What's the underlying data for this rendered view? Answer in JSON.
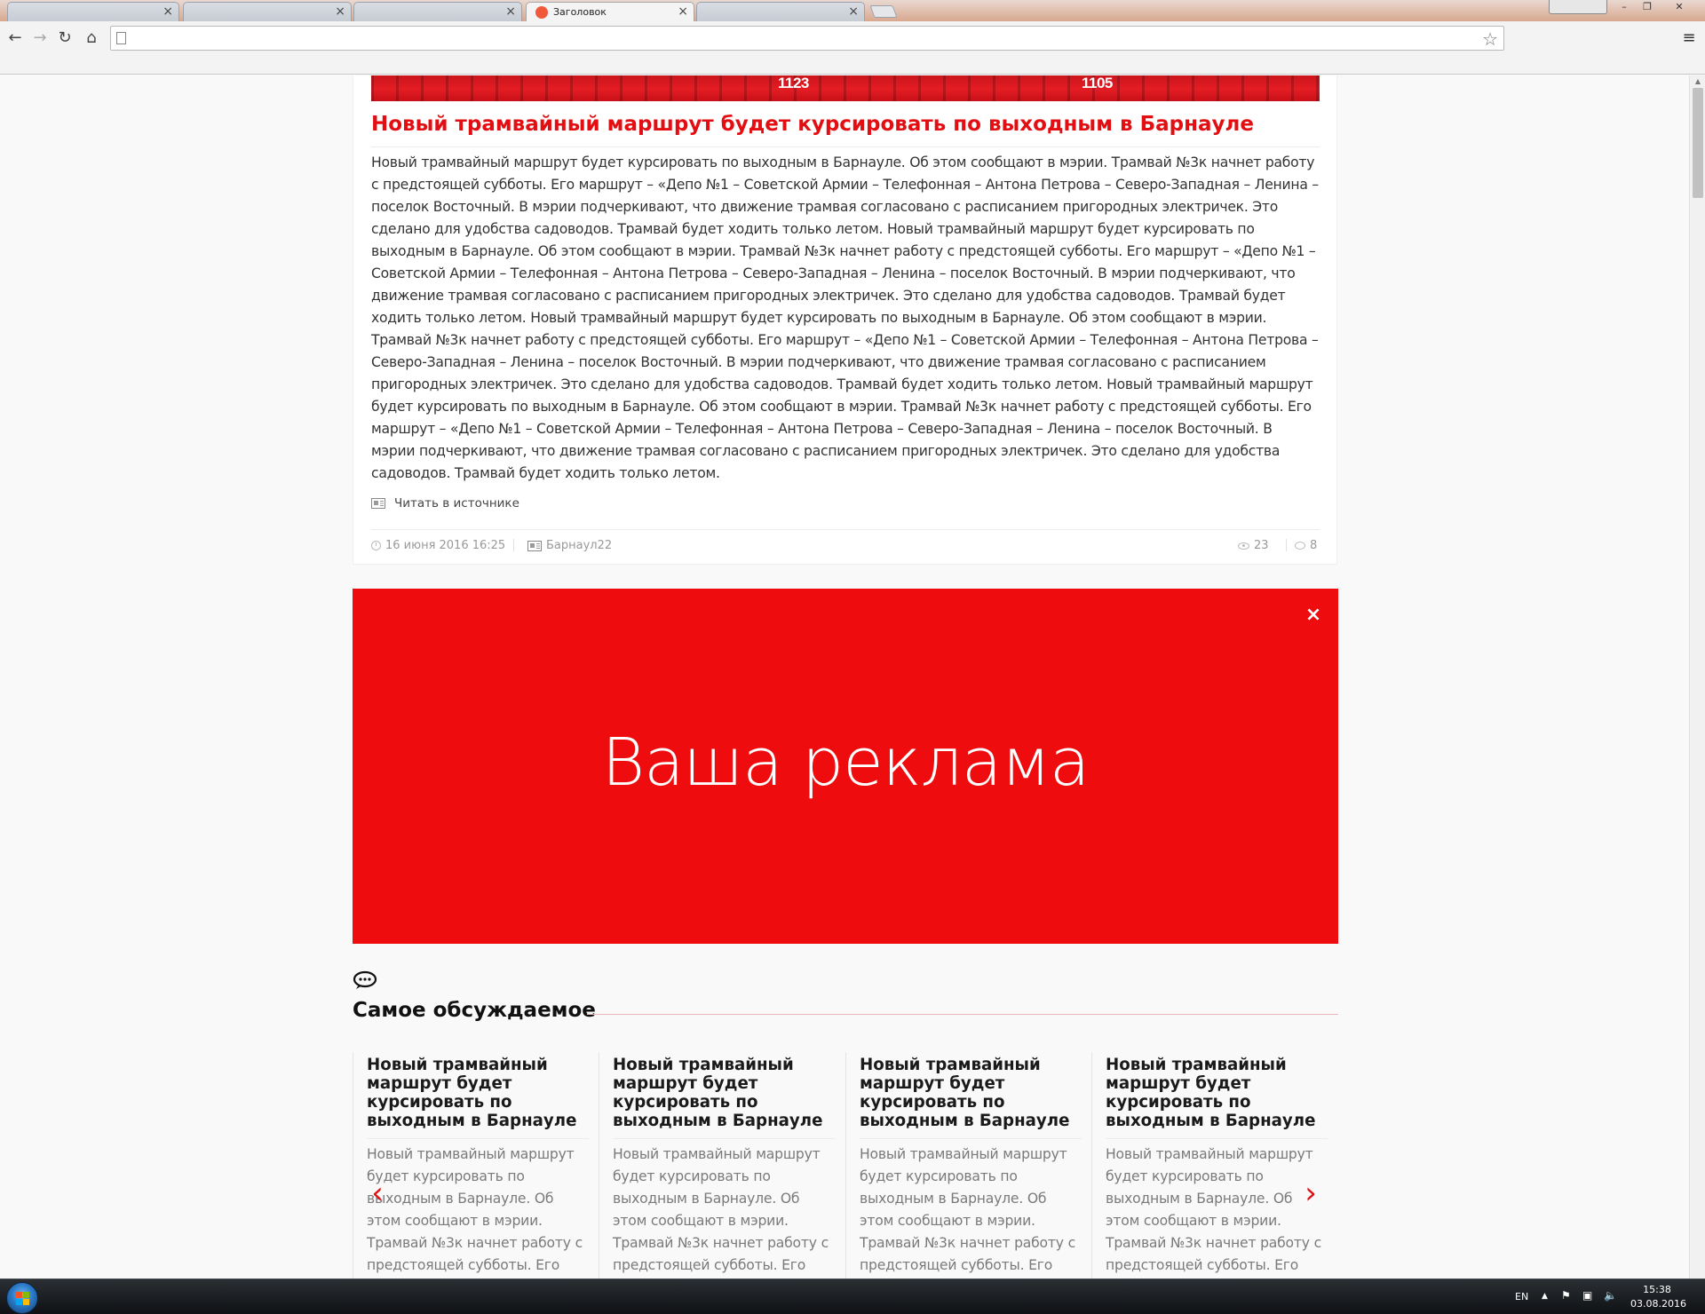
{
  "browser": {
    "tabs": [
      {
        "title": "",
        "active": false
      },
      {
        "title": "",
        "active": false
      },
      {
        "title": "",
        "active": false
      },
      {
        "title": "Заголовок",
        "active": true
      },
      {
        "title": "",
        "active": false
      }
    ],
    "tab_close_glyph": "×",
    "address": "",
    "nav": {
      "back": "←",
      "forward": "→",
      "reload": "↻",
      "home": "⌂",
      "star": "☆",
      "menu": "≡"
    }
  },
  "article": {
    "image_numbers": [
      "1123",
      "1105"
    ],
    "title": "Новый трамвайный маршрут будет курсировать по выходным в Барнауле",
    "body": "Новый трамвайный маршрут будет курсировать по выходным в Барнауле. Об этом сообщают в мэрии. Трамвай №3к начнет работу с предстоящей субботы. Его маршрут – «Депо №1 – Советской Армии – Телефонная – Антона Петрова – Северо-Западная – Ленина – поселок Восточный. В мэрии подчеркивают, что движение трамвая согласовано с расписанием пригородных электричек. Это сделано для удобства садоводов. Трамвай будет ходить только летом. Новый трамвайный маршрут будет курсировать по выходным в Барнауле. Об этом сообщают в мэрии. Трамвай №3к начнет работу с предстоящей субботы. Его маршрут – «Депо №1 – Советской Армии – Телефонная – Антона Петрова – Северо-Западная – Ленина – поселок Восточный. В мэрии подчеркивают, что движение трамвая согласовано с расписанием пригородных электричек. Это сделано для удобства садоводов. Трамвай будет ходить только летом. Новый трамвайный маршрут будет курсировать по выходным в Барнауле. Об этом сообщают в мэрии. Трамвай №3к начнет работу с предстоящей субботы. Его маршрут – «Депо №1 – Советской Армии – Телефонная – Антона Петрова – Северо-Западная – Ленина – поселок Восточный. В мэрии подчеркивают, что движение трамвая согласовано с расписанием пригородных электричек. Это сделано для удобства садоводов. Трамвай будет ходить только летом. Новый трамвайный маршрут будет курсировать по выходным в Барнауле. Об этом сообщают в мэрии. Трамвай №3к начнет работу с предстоящей субботы. Его маршрут – «Депо №1 – Советской Армии – Телефонная – Антона Петрова – Северо-Западная – Ленина – поселок Восточный. В мэрии подчеркивают, что движение трамвая согласовано с расписанием пригородных электричек. Это сделано для удобства садоводов. Трамвай будет ходить только летом.",
    "source_link": "Читать в источнике",
    "date": "16 июня 2016 16:25",
    "source_name": "Барнаул22",
    "views": "23",
    "comments": "8"
  },
  "ad": {
    "text": "Ваша реклама",
    "close_glyph": "×",
    "background": "#ee0c0e"
  },
  "most_discussed": {
    "icon": "speech-bubbles-icon",
    "title": "Самое обсуждаемое",
    "arrow_prev": "‹",
    "arrow_next": "›",
    "cards": [
      {
        "title": "Новый трамвайный маршрут будет курсировать по выходным в Барнауле",
        "text": "Новый трамвайный маршрут будет курсировать по выходным в Барнауле. Об этом сообщают в мэрии. Трамвай №3к начнет работу с предстоящей субботы. Его"
      },
      {
        "title": "Новый трамвайный маршрут будет курсировать по выходным в Барнауле",
        "text": "Новый трамвайный маршрут будет курсировать по выходным в Барнауле. Об этом сообщают в мэрии. Трамвай №3к начнет работу с предстоящей субботы. Его"
      },
      {
        "title": "Новый трамвайный маршрут будет курсировать по выходным в Барнауле",
        "text": "Новый трамвайный маршрут будет курсировать по выходным в Барнауле. Об этом сообщают в мэрии. Трамвай №3к начнет работу с предстоящей субботы. Его"
      },
      {
        "title": "Новый трамвайный маршрут будет курсировать по выходным в Барнауле",
        "text": "Новый трамвайный маршрут будет курсировать по выходным в Барнауле. Об этом сообщают в мэрии. Трамвай №3к начнет работу с предстоящей субботы. Его"
      }
    ]
  },
  "taskbar": {
    "language": "EN",
    "tray_arrow": "▲",
    "time": "15:38",
    "date": "03.08.2016"
  },
  "colors": {
    "accent": "#e30e12",
    "ad": "#ee0c0e"
  }
}
